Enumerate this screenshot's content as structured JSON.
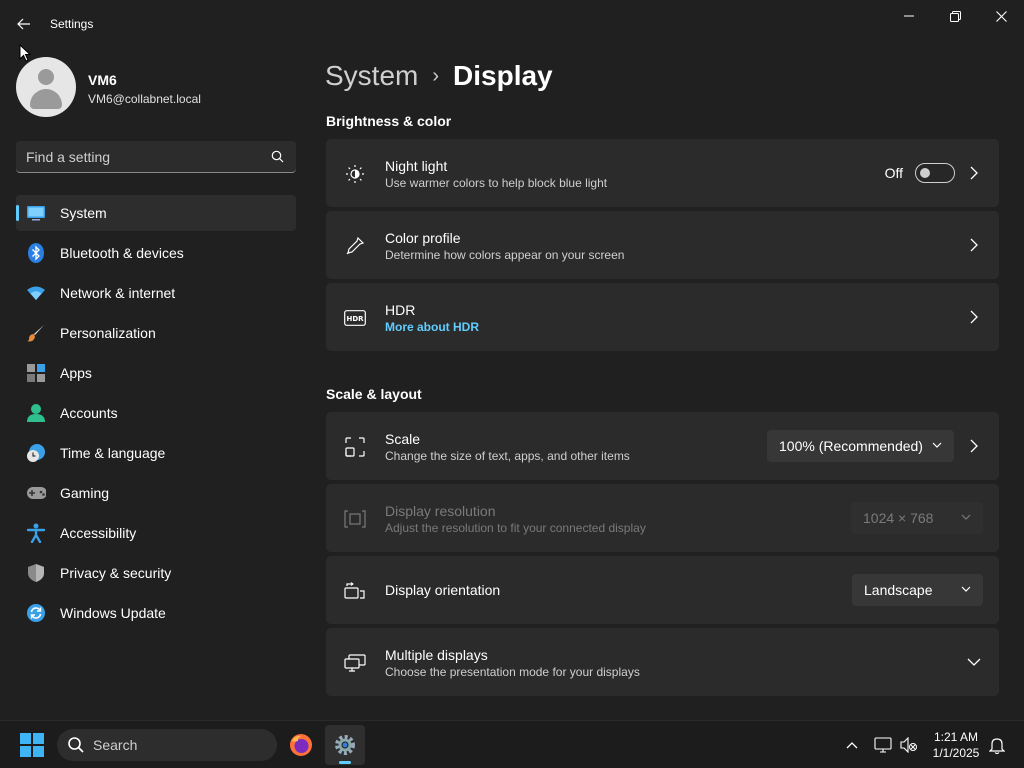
{
  "window": {
    "title": "Settings"
  },
  "user": {
    "name": "VM6",
    "email": "VM6@collabnet.local"
  },
  "sidebar": {
    "search_placeholder": "Find a setting",
    "items": [
      {
        "label": "System",
        "icon": "monitor-icon",
        "active": true
      },
      {
        "label": "Bluetooth & devices",
        "icon": "bluetooth-icon"
      },
      {
        "label": "Network & internet",
        "icon": "wifi-icon"
      },
      {
        "label": "Personalization",
        "icon": "brush-icon"
      },
      {
        "label": "Apps",
        "icon": "apps-icon"
      },
      {
        "label": "Accounts",
        "icon": "person-icon"
      },
      {
        "label": "Time & language",
        "icon": "globe-clock-icon"
      },
      {
        "label": "Gaming",
        "icon": "gamepad-icon"
      },
      {
        "label": "Accessibility",
        "icon": "accessibility-icon"
      },
      {
        "label": "Privacy & security",
        "icon": "shield-icon"
      },
      {
        "label": "Windows Update",
        "icon": "update-icon"
      }
    ]
  },
  "breadcrumb": {
    "parent": "System",
    "separator": "›",
    "current": "Display"
  },
  "sections": {
    "brightness": "Brightness & color",
    "scale_layout": "Scale & layout"
  },
  "cards": {
    "night_light": {
      "title": "Night light",
      "desc": "Use warmer colors to help block blue light",
      "state": "Off",
      "enabled": false
    },
    "color_profile": {
      "title": "Color profile",
      "desc": "Determine how colors appear on your screen"
    },
    "hdr": {
      "title": "HDR",
      "link": "More about HDR"
    },
    "scale": {
      "title": "Scale",
      "desc": "Change the size of text, apps, and other items",
      "value": "100% (Recommended)"
    },
    "resolution": {
      "title": "Display resolution",
      "desc": "Adjust the resolution to fit your connected display",
      "value": "1024 × 768",
      "disabled": true
    },
    "orientation": {
      "title": "Display orientation",
      "value": "Landscape"
    },
    "multiple": {
      "title": "Multiple displays",
      "desc": "Choose the presentation mode for your displays"
    }
  },
  "taskbar": {
    "search_label": "Search",
    "time": "1:21 AM",
    "date": "1/1/2025"
  },
  "colors": {
    "accent": "#60cdff",
    "background": "#202020",
    "card": "#2b2b2b"
  }
}
